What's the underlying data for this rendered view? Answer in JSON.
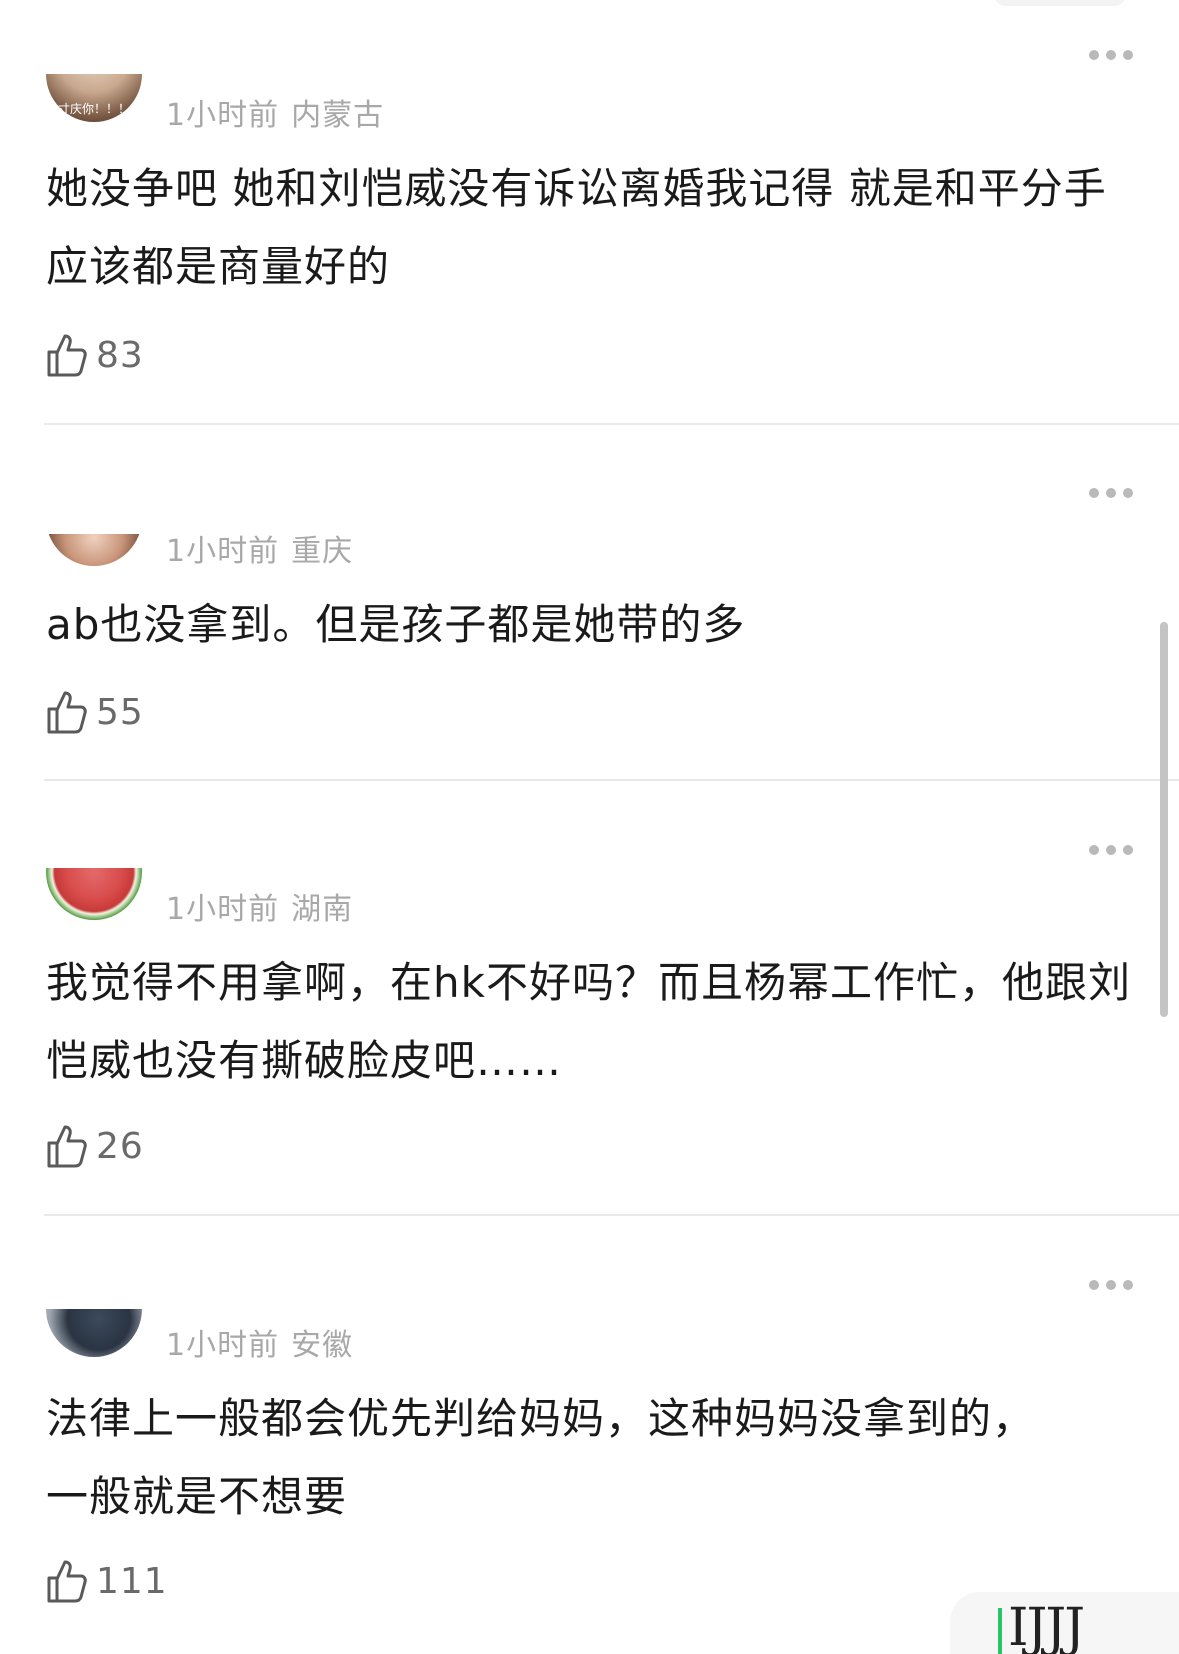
{
  "comments": [
    {
      "time": "1小时前",
      "location": "内蒙古",
      "text": "她没争吧 她和刘恺威没有诉讼离婚我记得 就是和平分手应该都是商量好的",
      "likes": "83",
      "avatar_caption": "寸庆你！！！"
    },
    {
      "time": "1小时前",
      "location": "重庆",
      "text": "ab也没拿到。但是孩子都是她带的多",
      "likes": "55"
    },
    {
      "time": "1小时前",
      "location": "湖南",
      "text": "我觉得不用拿啊，在hk不好吗？而且杨幂工作忙，他跟刘恺威也没有撕破脸皮吧……",
      "likes": "26"
    },
    {
      "time": "1小时前",
      "location": "安徽",
      "text": "法律上一般都会优先判给妈妈，这种妈妈没拿到的，一般就是不想要",
      "likes": "111"
    }
  ],
  "icons": {
    "like": "thumbs-up-icon",
    "more": "more-dots-icon"
  },
  "watermark": {
    "text": "IJJJ"
  },
  "colors": {
    "meta_text": "#a8a8a8",
    "body_text": "#1a1a1a",
    "like_text": "#6a6a6a",
    "divider": "#e9e9e9",
    "watermark_accent": "#27c46a"
  }
}
